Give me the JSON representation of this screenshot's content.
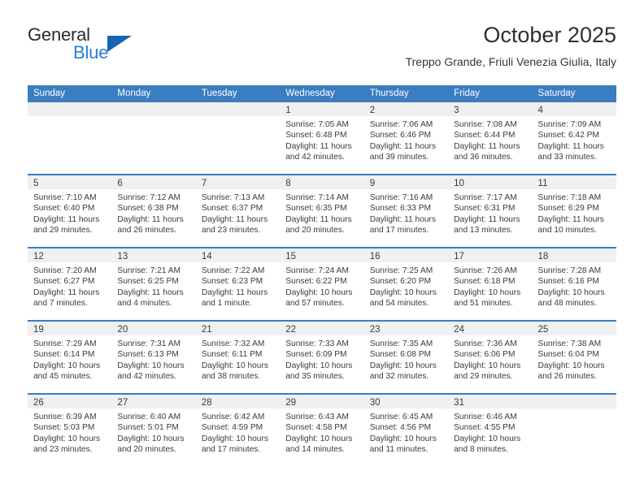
{
  "brand": {
    "word1": "General",
    "word2": "Blue",
    "triangle": "brand-triangle"
  },
  "header": {
    "month_title": "October 2025",
    "location": "Treppo Grande, Friuli Venezia Giulia, Italy"
  },
  "colors": {
    "header_blue": "#3a7dc0",
    "brand_blue": "#2a7fd4",
    "daynum_strip": "#f0f0f0",
    "text": "#3b3b3b"
  },
  "weekdays": [
    "Sunday",
    "Monday",
    "Tuesday",
    "Wednesday",
    "Thursday",
    "Friday",
    "Saturday"
  ],
  "weeks": [
    [
      {
        "day": "",
        "sunrise": "",
        "sunset": "",
        "daylight1": "",
        "daylight2": ""
      },
      {
        "day": "",
        "sunrise": "",
        "sunset": "",
        "daylight1": "",
        "daylight2": ""
      },
      {
        "day": "",
        "sunrise": "",
        "sunset": "",
        "daylight1": "",
        "daylight2": ""
      },
      {
        "day": "1",
        "sunrise": "Sunrise: 7:05 AM",
        "sunset": "Sunset: 6:48 PM",
        "daylight1": "Daylight: 11 hours",
        "daylight2": "and 42 minutes."
      },
      {
        "day": "2",
        "sunrise": "Sunrise: 7:06 AM",
        "sunset": "Sunset: 6:46 PM",
        "daylight1": "Daylight: 11 hours",
        "daylight2": "and 39 minutes."
      },
      {
        "day": "3",
        "sunrise": "Sunrise: 7:08 AM",
        "sunset": "Sunset: 6:44 PM",
        "daylight1": "Daylight: 11 hours",
        "daylight2": "and 36 minutes."
      },
      {
        "day": "4",
        "sunrise": "Sunrise: 7:09 AM",
        "sunset": "Sunset: 6:42 PM",
        "daylight1": "Daylight: 11 hours",
        "daylight2": "and 33 minutes."
      }
    ],
    [
      {
        "day": "5",
        "sunrise": "Sunrise: 7:10 AM",
        "sunset": "Sunset: 6:40 PM",
        "daylight1": "Daylight: 11 hours",
        "daylight2": "and 29 minutes."
      },
      {
        "day": "6",
        "sunrise": "Sunrise: 7:12 AM",
        "sunset": "Sunset: 6:38 PM",
        "daylight1": "Daylight: 11 hours",
        "daylight2": "and 26 minutes."
      },
      {
        "day": "7",
        "sunrise": "Sunrise: 7:13 AM",
        "sunset": "Sunset: 6:37 PM",
        "daylight1": "Daylight: 11 hours",
        "daylight2": "and 23 minutes."
      },
      {
        "day": "8",
        "sunrise": "Sunrise: 7:14 AM",
        "sunset": "Sunset: 6:35 PM",
        "daylight1": "Daylight: 11 hours",
        "daylight2": "and 20 minutes."
      },
      {
        "day": "9",
        "sunrise": "Sunrise: 7:16 AM",
        "sunset": "Sunset: 6:33 PM",
        "daylight1": "Daylight: 11 hours",
        "daylight2": "and 17 minutes."
      },
      {
        "day": "10",
        "sunrise": "Sunrise: 7:17 AM",
        "sunset": "Sunset: 6:31 PM",
        "daylight1": "Daylight: 11 hours",
        "daylight2": "and 13 minutes."
      },
      {
        "day": "11",
        "sunrise": "Sunrise: 7:18 AM",
        "sunset": "Sunset: 6:29 PM",
        "daylight1": "Daylight: 11 hours",
        "daylight2": "and 10 minutes."
      }
    ],
    [
      {
        "day": "12",
        "sunrise": "Sunrise: 7:20 AM",
        "sunset": "Sunset: 6:27 PM",
        "daylight1": "Daylight: 11 hours",
        "daylight2": "and 7 minutes."
      },
      {
        "day": "13",
        "sunrise": "Sunrise: 7:21 AM",
        "sunset": "Sunset: 6:25 PM",
        "daylight1": "Daylight: 11 hours",
        "daylight2": "and 4 minutes."
      },
      {
        "day": "14",
        "sunrise": "Sunrise: 7:22 AM",
        "sunset": "Sunset: 6:23 PM",
        "daylight1": "Daylight: 11 hours",
        "daylight2": "and 1 minute."
      },
      {
        "day": "15",
        "sunrise": "Sunrise: 7:24 AM",
        "sunset": "Sunset: 6:22 PM",
        "daylight1": "Daylight: 10 hours",
        "daylight2": "and 57 minutes."
      },
      {
        "day": "16",
        "sunrise": "Sunrise: 7:25 AM",
        "sunset": "Sunset: 6:20 PM",
        "daylight1": "Daylight: 10 hours",
        "daylight2": "and 54 minutes."
      },
      {
        "day": "17",
        "sunrise": "Sunrise: 7:26 AM",
        "sunset": "Sunset: 6:18 PM",
        "daylight1": "Daylight: 10 hours",
        "daylight2": "and 51 minutes."
      },
      {
        "day": "18",
        "sunrise": "Sunrise: 7:28 AM",
        "sunset": "Sunset: 6:16 PM",
        "daylight1": "Daylight: 10 hours",
        "daylight2": "and 48 minutes."
      }
    ],
    [
      {
        "day": "19",
        "sunrise": "Sunrise: 7:29 AM",
        "sunset": "Sunset: 6:14 PM",
        "daylight1": "Daylight: 10 hours",
        "daylight2": "and 45 minutes."
      },
      {
        "day": "20",
        "sunrise": "Sunrise: 7:31 AM",
        "sunset": "Sunset: 6:13 PM",
        "daylight1": "Daylight: 10 hours",
        "daylight2": "and 42 minutes."
      },
      {
        "day": "21",
        "sunrise": "Sunrise: 7:32 AM",
        "sunset": "Sunset: 6:11 PM",
        "daylight1": "Daylight: 10 hours",
        "daylight2": "and 38 minutes."
      },
      {
        "day": "22",
        "sunrise": "Sunrise: 7:33 AM",
        "sunset": "Sunset: 6:09 PM",
        "daylight1": "Daylight: 10 hours",
        "daylight2": "and 35 minutes."
      },
      {
        "day": "23",
        "sunrise": "Sunrise: 7:35 AM",
        "sunset": "Sunset: 6:08 PM",
        "daylight1": "Daylight: 10 hours",
        "daylight2": "and 32 minutes."
      },
      {
        "day": "24",
        "sunrise": "Sunrise: 7:36 AM",
        "sunset": "Sunset: 6:06 PM",
        "daylight1": "Daylight: 10 hours",
        "daylight2": "and 29 minutes."
      },
      {
        "day": "25",
        "sunrise": "Sunrise: 7:38 AM",
        "sunset": "Sunset: 6:04 PM",
        "daylight1": "Daylight: 10 hours",
        "daylight2": "and 26 minutes."
      }
    ],
    [
      {
        "day": "26",
        "sunrise": "Sunrise: 6:39 AM",
        "sunset": "Sunset: 5:03 PM",
        "daylight1": "Daylight: 10 hours",
        "daylight2": "and 23 minutes."
      },
      {
        "day": "27",
        "sunrise": "Sunrise: 6:40 AM",
        "sunset": "Sunset: 5:01 PM",
        "daylight1": "Daylight: 10 hours",
        "daylight2": "and 20 minutes."
      },
      {
        "day": "28",
        "sunrise": "Sunrise: 6:42 AM",
        "sunset": "Sunset: 4:59 PM",
        "daylight1": "Daylight: 10 hours",
        "daylight2": "and 17 minutes."
      },
      {
        "day": "29",
        "sunrise": "Sunrise: 6:43 AM",
        "sunset": "Sunset: 4:58 PM",
        "daylight1": "Daylight: 10 hours",
        "daylight2": "and 14 minutes."
      },
      {
        "day": "30",
        "sunrise": "Sunrise: 6:45 AM",
        "sunset": "Sunset: 4:56 PM",
        "daylight1": "Daylight: 10 hours",
        "daylight2": "and 11 minutes."
      },
      {
        "day": "31",
        "sunrise": "Sunrise: 6:46 AM",
        "sunset": "Sunset: 4:55 PM",
        "daylight1": "Daylight: 10 hours",
        "daylight2": "and 8 minutes."
      },
      {
        "day": "",
        "sunrise": "",
        "sunset": "",
        "daylight1": "",
        "daylight2": ""
      }
    ]
  ]
}
